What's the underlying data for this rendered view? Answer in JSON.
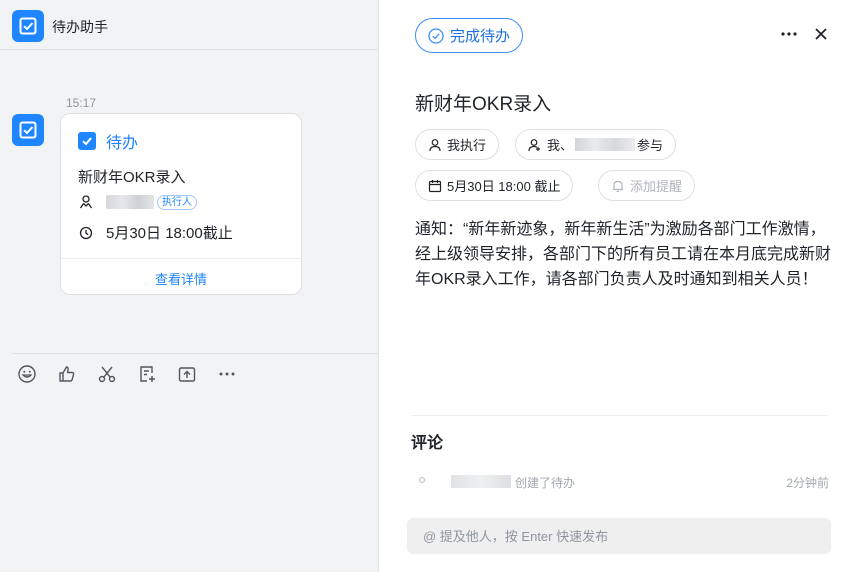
{
  "left_pane": {
    "header_title": "待办助手",
    "message": {
      "time": "15:17",
      "card": {
        "tag": "待办",
        "title": "新财年OKR录入",
        "assignee_role": "执行人",
        "due": "5月30日 18:00截止",
        "detail_link": "查看详情"
      }
    },
    "toolbar_icons": [
      "emoji-icon",
      "thumbs-up-icon",
      "scissors-icon",
      "note-add-icon",
      "share-icon",
      "more-icon"
    ]
  },
  "right_pane": {
    "complete_label": "完成待办",
    "title": "新财年OKR录入",
    "chips": {
      "assignee": "我执行",
      "followers_prefix": "我、",
      "followers_suffix": "参与",
      "due": "5月30日 18:00 截止",
      "reminder": "添加提醒"
    },
    "description": "通知：“新年新迹象，新年新生活”为激励各部门工作激情，经上级领导安排，各部门下的所有员工请在本月底完成新财年OKR录入工作，请各部门负责人及时通知到相关人员！",
    "comments": {
      "heading": "评论",
      "activity": {
        "text": "创建了待办",
        "time": "2分钟前"
      },
      "placeholder": "@ 提及他人，按 Enter 快速发布"
    }
  },
  "colors": {
    "accent": "#1f86ff",
    "left_background": "#f2f3f5",
    "text_primary": "#1f2329",
    "text_muted": "#8f959e"
  }
}
